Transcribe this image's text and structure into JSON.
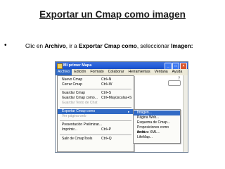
{
  "slide": {
    "title": "Exportar un Cmap como imagen",
    "bullet_symbol": "•",
    "instruction": {
      "p1": "Clic en ",
      "b1": "Archivo",
      "p2": ", ir a ",
      "b2": "Exportar Cmap como",
      "p3": ", seleccionar ",
      "b3": "Imagen:"
    }
  },
  "window": {
    "title": "Mi primer Mapa",
    "buttons": {
      "minimize": "_",
      "maximize": "□",
      "close": "×"
    },
    "menu": [
      "Archivo",
      "Edición",
      "Formato",
      "Colaborar",
      "Herramientas",
      "Ventana",
      "Ayuda"
    ],
    "active_menu": "Archivo",
    "accent": "#316ac5"
  },
  "file_menu": {
    "items": [
      {
        "label": "Nuevo Cmap",
        "shortcut": "Ctrl+N"
      },
      {
        "label": "Cerrar Cmap",
        "shortcut": "Ctrl+W"
      },
      {
        "label": "Guardar Cmap",
        "shortcut": "Ctrl+S"
      },
      {
        "label": "Guardar Cmap como...",
        "shortcut": "Ctrl+Mayúsculas+S"
      },
      {
        "label": "Guardar Texto de Chat",
        "shortcut": ""
      },
      {
        "label": "Exportar Cmap como",
        "shortcut": "",
        "arrow": "▸"
      },
      {
        "label": "Ver página web",
        "shortcut": ""
      },
      {
        "label": "Presentación Preliminar...",
        "shortcut": ""
      },
      {
        "label": "Imprimir...",
        "shortcut": "Ctrl+P"
      },
      {
        "label": "Salir de CmapTools",
        "shortcut": "Ctrl+Q"
      }
    ]
  },
  "export_submenu": {
    "items": [
      "Imagen...",
      "Página Web...",
      "Esquema de Cmap...",
      "Proposiciones como texto...",
      "Archivo XML...",
      "LifeMap..."
    ]
  }
}
